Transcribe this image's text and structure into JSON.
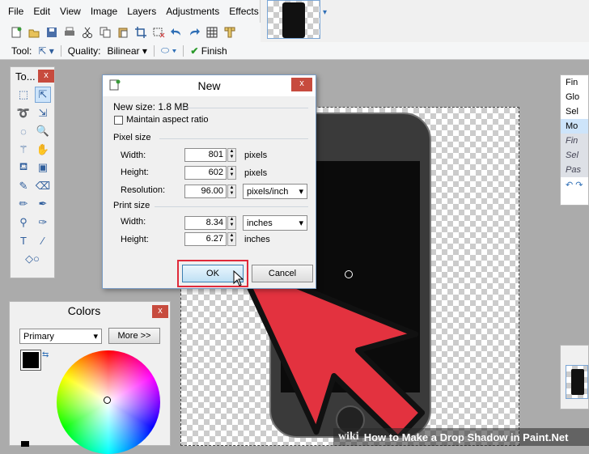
{
  "menu": [
    "File",
    "Edit",
    "View",
    "Image",
    "Layers",
    "Adjustments",
    "Effects"
  ],
  "toolbar2": {
    "tool_label": "Tool:",
    "quality_label": "Quality:",
    "quality_value": "Bilinear",
    "finish_label": "Finish"
  },
  "tools_panel": {
    "title": "To...",
    "close": "x"
  },
  "colors_panel": {
    "title": "Colors",
    "close": "x",
    "mode": "Primary",
    "more": "More >>"
  },
  "dialog": {
    "title": "New",
    "close": "x",
    "new_size": "New size: 1.8 MB",
    "maintain_aspect": "Maintain aspect ratio",
    "pixel_size_label": "Pixel size",
    "width_label": "Width:",
    "width_value": "801",
    "width_unit": "pixels",
    "height_label": "Height:",
    "height_value": "602",
    "height_unit": "pixels",
    "resolution_label": "Resolution:",
    "resolution_value": "96.00",
    "resolution_unit": "pixels/inch",
    "print_size_label": "Print size",
    "print_width_label": "Width:",
    "print_width_value": "8.34",
    "print_width_unit": "inches",
    "print_height_label": "Height:",
    "print_height_value": "6.27",
    "print_height_unit": "inches",
    "ok": "OK",
    "cancel": "Cancel"
  },
  "history_items": [
    "Fin",
    "Glo",
    "Sel",
    "Mo",
    "Fin",
    "Sel",
    "Pas"
  ],
  "footer": {
    "brand": "wiki",
    "text": "How to Make a Drop Shadow in Paint.Net"
  },
  "colors": {
    "highlight": "#e02a3a",
    "arrow": "#e3323f"
  }
}
